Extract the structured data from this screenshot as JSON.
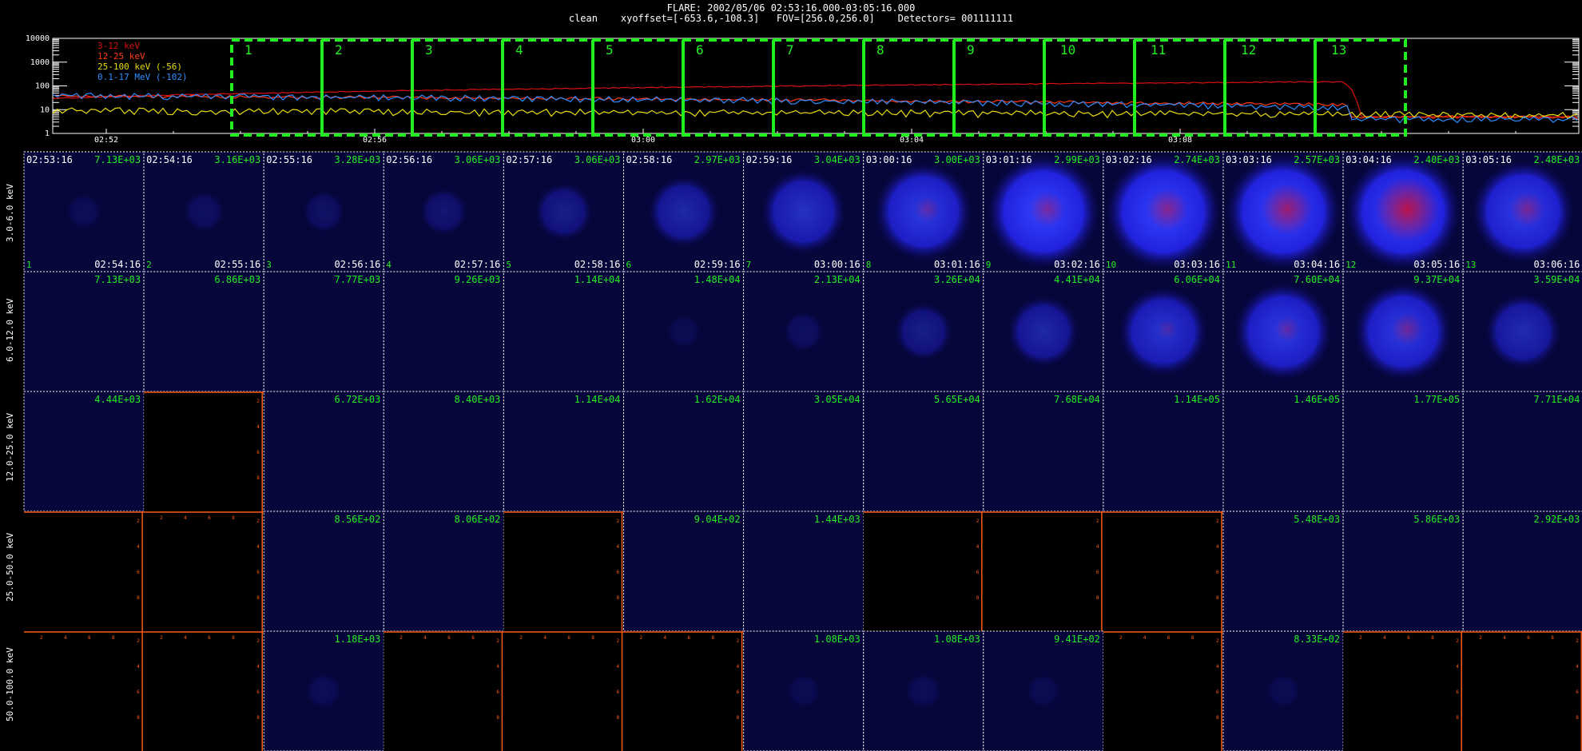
{
  "header": {
    "title": "FLARE: 2002/05/06 02:53:16.000-03:05:16.000",
    "subtitle": "clean    xyoffset=[-653.6,-108.3]   FOV=[256.0,256.0]    Detectors= 001111111"
  },
  "lightcurve": {
    "y_ticks": [
      "10000",
      "1000",
      "100",
      "10",
      "1"
    ],
    "x_ticks": [
      "02:52",
      "02:56",
      "03:00",
      "03:04",
      "03:08"
    ],
    "legend": [
      {
        "label": "3-12 keV",
        "color": "#d81010"
      },
      {
        "label": "12-25 keV",
        "color": "#ff3a14"
      },
      {
        "label": "25-100 keV (-56)",
        "color": "#e8dc10"
      },
      {
        "label": "0.1-17 MeV (-102)",
        "color": "#2f8cff"
      }
    ],
    "interval_numbers": [
      "1",
      "2",
      "3",
      "4",
      "5",
      "6",
      "7",
      "8",
      "9",
      "10",
      "11",
      "12",
      "13"
    ],
    "interval_color": "#22ee22"
  },
  "grid": {
    "row_labels": [
      "3.0-6.0 keV",
      "6.0-12.0 keV",
      "12.0-25.0 keV",
      "25.0-50.0 keV",
      "50.0-100.0 keV"
    ],
    "start_times": [
      "02:53:16",
      "02:54:16",
      "02:55:16",
      "02:56:16",
      "02:57:16",
      "02:58:16",
      "02:59:16",
      "03:00:16",
      "03:01:16",
      "03:02:16",
      "03:03:16",
      "03:04:16",
      "03:05:16"
    ],
    "end_times": [
      "02:54:16",
      "02:55:16",
      "02:56:16",
      "02:57:16",
      "02:58:16",
      "02:59:16",
      "03:00:16",
      "03:01:16",
      "03:02:16",
      "03:03:16",
      "03:04:16",
      "03:05:16",
      "03:06:16"
    ],
    "cell_numbers": [
      "1",
      "2",
      "3",
      "4",
      "5",
      "6",
      "7",
      "8",
      "9",
      "10",
      "11",
      "12",
      "13"
    ],
    "axis_numbers": [
      "2",
      "4",
      "6",
      "8"
    ],
    "cells": [
      [
        {
          "v": "7.13E+03",
          "i": 0.05,
          "r": 0
        },
        {
          "v": "3.16E+03",
          "i": 0.1,
          "r": 0
        },
        {
          "v": "3.28E+03",
          "i": 0.12,
          "r": 0
        },
        {
          "v": "3.06E+03",
          "i": 0.18,
          "r": 0
        },
        {
          "v": "3.06E+03",
          "i": 0.3,
          "r": 0
        },
        {
          "v": "2.97E+03",
          "i": 0.45,
          "r": 0
        },
        {
          "v": "3.04E+03",
          "i": 0.6,
          "r": 0
        },
        {
          "v": "3.00E+03",
          "i": 0.75,
          "r": 0.15
        },
        {
          "v": "2.99E+03",
          "i": 0.92,
          "r": 0.3
        },
        {
          "v": "2.74E+03",
          "i": 0.95,
          "r": 0.4
        },
        {
          "v": "2.57E+03",
          "i": 0.95,
          "r": 0.55
        },
        {
          "v": "2.40E+03",
          "i": 0.95,
          "r": 0.75
        },
        {
          "v": "2.48E+03",
          "i": 0.8,
          "r": 0.3
        }
      ],
      [
        {
          "v": "7.13E+03",
          "i": 0,
          "r": 0
        },
        {
          "v": "6.86E+03",
          "i": 0,
          "r": 0
        },
        {
          "v": "7.77E+03",
          "i": 0,
          "r": 0
        },
        {
          "v": "9.26E+03",
          "i": 0,
          "r": 0
        },
        {
          "v": "1.14E+04",
          "i": 0,
          "r": 0
        },
        {
          "v": "1.48E+04",
          "i": 0.03,
          "r": 0
        },
        {
          "v": "2.13E+04",
          "i": 0.1,
          "r": 0
        },
        {
          "v": "3.26E+04",
          "i": 0.3,
          "r": 0
        },
        {
          "v": "4.41E+04",
          "i": 0.45,
          "r": 0
        },
        {
          "v": "6.06E+04",
          "i": 0.65,
          "r": 0.05
        },
        {
          "v": "7.60E+04",
          "i": 0.75,
          "r": 0.15
        },
        {
          "v": "9.37E+04",
          "i": 0.75,
          "r": 0.25
        },
        {
          "v": "3.59E+04",
          "i": 0.5,
          "r": 0
        }
      ],
      [
        {
          "v": "4.44E+03",
          "i": 0,
          "r": 0
        },
        {
          "v": "",
          "i": -1,
          "r": 0
        },
        {
          "v": "6.72E+03",
          "i": 0,
          "r": 0
        },
        {
          "v": "8.40E+03",
          "i": 0,
          "r": 0
        },
        {
          "v": "1.14E+04",
          "i": 0,
          "r": 0
        },
        {
          "v": "1.62E+04",
          "i": 0,
          "r": 0
        },
        {
          "v": "3.05E+04",
          "i": 0,
          "r": 0
        },
        {
          "v": "5.65E+04",
          "i": 0,
          "r": 0
        },
        {
          "v": "7.68E+04",
          "i": 0,
          "r": 0
        },
        {
          "v": "1.14E+05",
          "i": 0,
          "r": 0
        },
        {
          "v": "1.46E+05",
          "i": 0,
          "r": 0
        },
        {
          "v": "1.77E+05",
          "i": 0,
          "r": 0
        },
        {
          "v": "7.71E+04",
          "i": 0,
          "r": 0
        }
      ],
      [
        {
          "v": "",
          "i": -1,
          "r": 0
        },
        {
          "v": "",
          "i": -1,
          "r": 0
        },
        {
          "v": "8.56E+02",
          "i": 0,
          "r": 0
        },
        {
          "v": "8.06E+02",
          "i": 0,
          "r": 0
        },
        {
          "v": "",
          "i": -1,
          "r": 0
        },
        {
          "v": "9.04E+02",
          "i": 0,
          "r": 0
        },
        {
          "v": "1.44E+03",
          "i": 0,
          "r": 0
        },
        {
          "v": "",
          "i": -1,
          "r": 0
        },
        {
          "v": "",
          "i": -1,
          "r": 0
        },
        {
          "v": "",
          "i": -1,
          "r": 0
        },
        {
          "v": "5.48E+03",
          "i": 0,
          "r": 0
        },
        {
          "v": "5.86E+03",
          "i": 0,
          "r": 0
        },
        {
          "v": "2.92E+03",
          "i": 0,
          "r": 0
        }
      ],
      [
        {
          "v": "",
          "i": -1,
          "r": 0
        },
        {
          "v": "",
          "i": -1,
          "r": 0
        },
        {
          "v": "1.18E+03",
          "i": 0.05,
          "r": 0
        },
        {
          "v": "",
          "i": -1,
          "r": 0
        },
        {
          "v": "",
          "i": -1,
          "r": 0
        },
        {
          "v": "",
          "i": -1,
          "r": 0
        },
        {
          "v": "1.08E+03",
          "i": 0.03,
          "r": 0
        },
        {
          "v": "1.08E+03",
          "i": 0.05,
          "r": 0
        },
        {
          "v": "9.41E+02",
          "i": 0.03,
          "r": 0
        },
        {
          "v": "",
          "i": -1,
          "r": 0
        },
        {
          "v": "8.33E+02",
          "i": 0.03,
          "r": 0
        },
        {
          "v": "",
          "i": -1,
          "r": 0
        },
        {
          "v": "",
          "i": -1,
          "r": 0
        }
      ]
    ],
    "colors": {
      "label_green": "#22ee22",
      "grid_border": "#ffffff",
      "empty_axis": "#ff5a14",
      "cell_bg": "#06063a"
    }
  }
}
